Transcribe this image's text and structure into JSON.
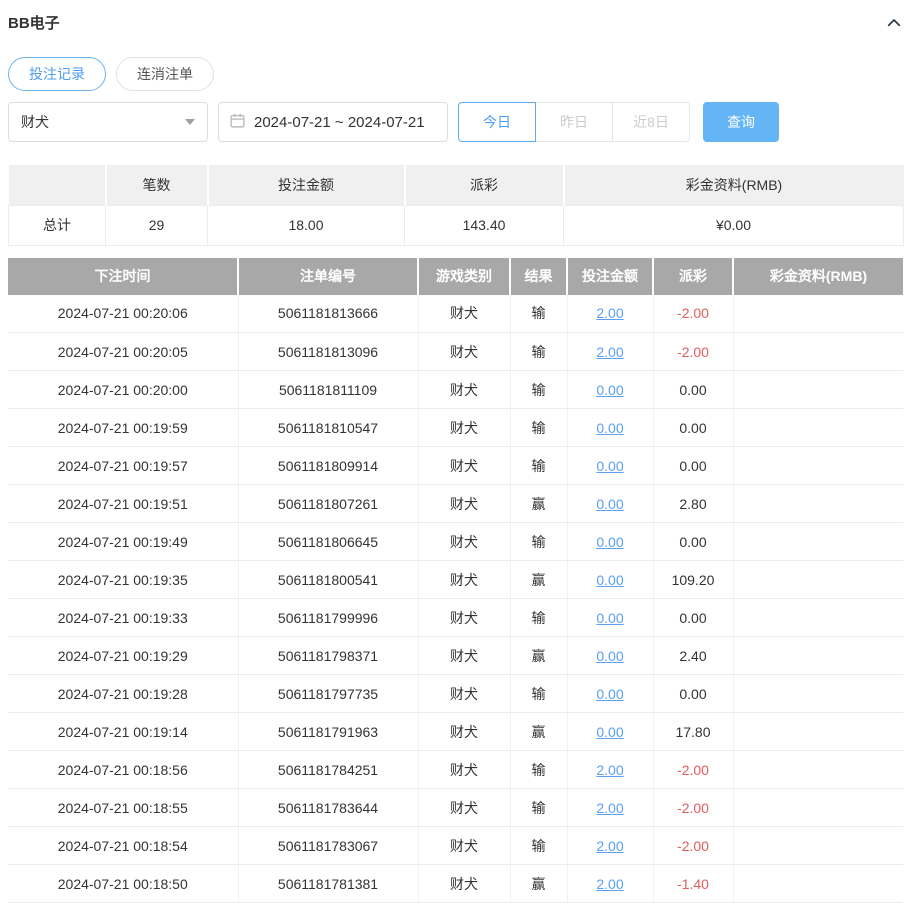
{
  "header": {
    "title": "BB电子"
  },
  "tabs": [
    {
      "label": "投注记录",
      "active": true
    },
    {
      "label": "连消注单",
      "active": false
    }
  ],
  "filters": {
    "game_select": {
      "value": "财犬"
    },
    "date_range": {
      "value": "2024-07-21 ~ 2024-07-21"
    },
    "quick_buttons": [
      {
        "label": "今日",
        "active": true
      },
      {
        "label": "昨日",
        "active": false
      },
      {
        "label": "近8日",
        "active": false
      }
    ],
    "search_button": {
      "label": "查询"
    }
  },
  "summary": {
    "columns": [
      "",
      "笔数",
      "投注金额",
      "派彩",
      "彩金资料(RMB)"
    ],
    "total": {
      "label": "总计",
      "count": "29",
      "bet_amount": "18.00",
      "payout": "143.40",
      "bonus": "¥0.00"
    }
  },
  "table": {
    "columns": [
      "下注时间",
      "注单编号",
      "游戏类别",
      "结果",
      "投注金额",
      "派彩",
      "彩金资料(RMB)"
    ],
    "rows": [
      {
        "time": "2024-07-21 00:20:06",
        "order_id": "5061181813666",
        "game": "财犬",
        "result": "输",
        "bet": "2.00",
        "payout": "-2.00",
        "bonus": ""
      },
      {
        "time": "2024-07-21 00:20:05",
        "order_id": "5061181813096",
        "game": "财犬",
        "result": "输",
        "bet": "2.00",
        "payout": "-2.00",
        "bonus": ""
      },
      {
        "time": "2024-07-21 00:20:00",
        "order_id": "5061181811109",
        "game": "财犬",
        "result": "输",
        "bet": "0.00",
        "payout": "0.00",
        "bonus": ""
      },
      {
        "time": "2024-07-21 00:19:59",
        "order_id": "5061181810547",
        "game": "财犬",
        "result": "输",
        "bet": "0.00",
        "payout": "0.00",
        "bonus": ""
      },
      {
        "time": "2024-07-21 00:19:57",
        "order_id": "5061181809914",
        "game": "财犬",
        "result": "输",
        "bet": "0.00",
        "payout": "0.00",
        "bonus": ""
      },
      {
        "time": "2024-07-21 00:19:51",
        "order_id": "5061181807261",
        "game": "财犬",
        "result": "赢",
        "bet": "0.00",
        "payout": "2.80",
        "bonus": ""
      },
      {
        "time": "2024-07-21 00:19:49",
        "order_id": "5061181806645",
        "game": "财犬",
        "result": "输",
        "bet": "0.00",
        "payout": "0.00",
        "bonus": ""
      },
      {
        "time": "2024-07-21 00:19:35",
        "order_id": "5061181800541",
        "game": "财犬",
        "result": "赢",
        "bet": "0.00",
        "payout": "109.20",
        "bonus": ""
      },
      {
        "time": "2024-07-21 00:19:33",
        "order_id": "5061181799996",
        "game": "财犬",
        "result": "输",
        "bet": "0.00",
        "payout": "0.00",
        "bonus": ""
      },
      {
        "time": "2024-07-21 00:19:29",
        "order_id": "5061181798371",
        "game": "财犬",
        "result": "赢",
        "bet": "0.00",
        "payout": "2.40",
        "bonus": ""
      },
      {
        "time": "2024-07-21 00:19:28",
        "order_id": "5061181797735",
        "game": "财犬",
        "result": "输",
        "bet": "0.00",
        "payout": "0.00",
        "bonus": ""
      },
      {
        "time": "2024-07-21 00:19:14",
        "order_id": "5061181791963",
        "game": "财犬",
        "result": "赢",
        "bet": "0.00",
        "payout": "17.80",
        "bonus": ""
      },
      {
        "time": "2024-07-21 00:18:56",
        "order_id": "5061181784251",
        "game": "财犬",
        "result": "输",
        "bet": "2.00",
        "payout": "-2.00",
        "bonus": ""
      },
      {
        "time": "2024-07-21 00:18:55",
        "order_id": "5061181783644",
        "game": "财犬",
        "result": "输",
        "bet": "2.00",
        "payout": "-2.00",
        "bonus": ""
      },
      {
        "time": "2024-07-21 00:18:54",
        "order_id": "5061181783067",
        "game": "财犬",
        "result": "输",
        "bet": "2.00",
        "payout": "-2.00",
        "bonus": ""
      },
      {
        "time": "2024-07-21 00:18:50",
        "order_id": "5061181781381",
        "game": "财犬",
        "result": "赢",
        "bet": "2.00",
        "payout": "-1.40",
        "bonus": ""
      }
    ]
  },
  "icons": {
    "collapse": "chevron-up-icon",
    "calendar": "calendar-icon",
    "select_caret": "caret-down-icon"
  },
  "colors": {
    "accent_blue": "#4f9df0",
    "link_blue": "#5b9ff0",
    "search_button_bg": "#64b5f6",
    "negative_red": "#e25d5d",
    "table_header_bg": "#a8a8a8",
    "summary_header_bg": "#f0f0f0",
    "muted_gray": "#cccccc"
  }
}
